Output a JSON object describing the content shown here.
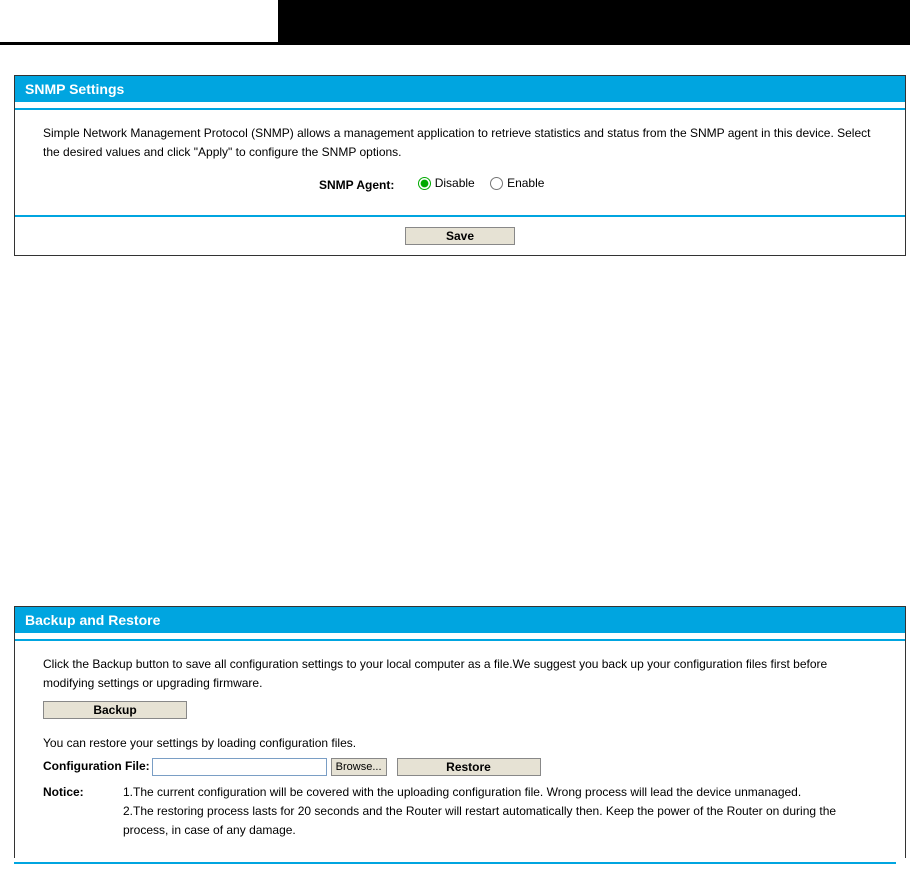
{
  "snmp": {
    "title": "SNMP Settings",
    "description": "Simple Network Management Protocol (SNMP) allows a management application to retrieve statistics and status from the SNMP agent in this device. Select the desired values and click \"Apply\" to configure the SNMP options.",
    "agent_label": "SNMP Agent:",
    "options": {
      "disable": "Disable",
      "enable": "Enable"
    },
    "save_label": "Save"
  },
  "backup": {
    "title": "Backup and Restore",
    "backup_text": "Click the Backup button to save all configuration settings to your local computer as a file.We suggest you back up your configuration files first before modifying settings or upgrading firmware.",
    "backup_button": "Backup",
    "restore_text": "You can restore your settings by loading configuration files.",
    "config_label": "Configuration File:",
    "browse_label": "Browse...",
    "restore_button": "Restore",
    "notice_label": "Notice:",
    "notice_1": "1.The current configuration will be covered with the uploading configuration file. Wrong process will lead the device unmanaged.",
    "notice_2": "2.The restoring process lasts for 20 seconds and the Router will restart automatically then. Keep the power of the Router on during the process, in case of any damage."
  }
}
